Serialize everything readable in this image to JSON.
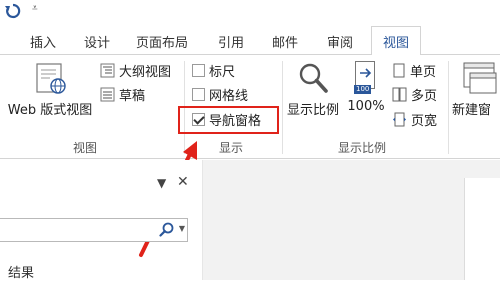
{
  "quick_access": {
    "undo_icon": "undo-icon",
    "dropdown_glyph": "⩡"
  },
  "tabs": [
    {
      "label": "插入"
    },
    {
      "label": "设计"
    },
    {
      "label": "页面布局"
    },
    {
      "label": "引用"
    },
    {
      "label": "邮件"
    },
    {
      "label": "审阅"
    },
    {
      "label": "视图",
      "active": true
    }
  ],
  "ribbon": {
    "views_group": {
      "web_layout": "Web 版式视图",
      "outline": "大纲视图",
      "draft": "草稿",
      "label": "视图"
    },
    "show_group": {
      "ruler": {
        "label": "标尺",
        "checked": false
      },
      "gridlines": {
        "label": "网格线",
        "checked": false
      },
      "navigation_pane": {
        "label": "导航窗格",
        "checked": true
      },
      "label": "显示"
    },
    "zoom_group": {
      "zoom": "显示比例",
      "hundred": "100%",
      "hundred_badge": "100",
      "one_page": "单页",
      "multi_page": "多页",
      "page_width": "页宽",
      "label": "显示比例"
    },
    "new_window": "新建窗"
  },
  "nav_pane": {
    "dropdown_glyph": "▼",
    "close_glyph": "✕",
    "search_value": "",
    "search_arrow": "▼",
    "results_label": "结果"
  },
  "colors": {
    "accent": "#2b579a",
    "highlight": "#e0231a",
    "arrow": "#e0231a"
  }
}
